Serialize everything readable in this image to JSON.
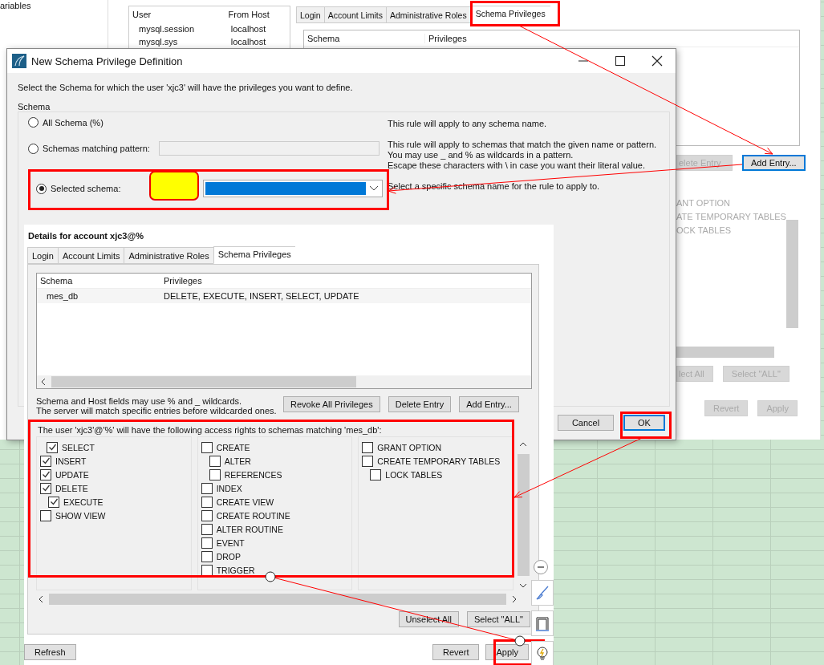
{
  "main_window": {
    "sidebar_label": "ariables",
    "users_table": {
      "columns": [
        "User",
        "From Host"
      ],
      "rows": [
        [
          "mysql.session",
          "localhost"
        ],
        [
          "mysql.sys",
          "localhost"
        ]
      ]
    },
    "tabs": [
      {
        "label": "Login",
        "selected": false
      },
      {
        "label": "Account Limits",
        "selected": false
      },
      {
        "label": "Administrative Roles",
        "selected": false
      },
      {
        "label": "Schema Privileges",
        "selected": true
      }
    ],
    "privileges_table": {
      "columns": [
        "Schema",
        "Privileges"
      ]
    },
    "entry_buttons": [
      {
        "label": "elete Entry",
        "focused": false
      },
      {
        "label": "Add Entry...",
        "focused": true
      }
    ],
    "privileges": [
      "ANT OPTION",
      "ATE TEMPORARY TABLES",
      "OCK TABLES"
    ],
    "select_buttons": [
      "lect All",
      "Select \"ALL\""
    ],
    "footer_buttons": [
      "Revert",
      "Apply"
    ]
  },
  "dialog": {
    "title": "New Schema Privilege Definition",
    "instruction": "Select the Schema for which the user 'xjc3' will have the privileges you want to define.",
    "group_label": "Schema",
    "options": [
      {
        "kind": "plain",
        "label": "All Schema (%)",
        "selected": false,
        "help": [
          "This rule will apply to any schema name."
        ]
      },
      {
        "kind": "pattern",
        "label": "Schemas matching pattern:",
        "selected": false,
        "help": [
          "This rule will apply to schemas that match the given name or pattern.",
          "You may use _ and % as wildcards in a pattern.",
          "Escape these characters with \\ in case you want their literal value."
        ]
      },
      {
        "kind": "dropdown",
        "label": "Selected schema:",
        "selected": true,
        "help": [
          "Select a specific schema name for the rule to apply to."
        ]
      }
    ],
    "buttons": [
      {
        "label": "Cancel",
        "focused": false
      },
      {
        "label": "OK",
        "focused": true
      }
    ]
  },
  "details": {
    "title": "Details for account xjc3@%",
    "tabs": [
      {
        "label": "Login",
        "selected": false
      },
      {
        "label": "Account Limits",
        "selected": false
      },
      {
        "label": "Administrative Roles",
        "selected": false
      },
      {
        "label": "Schema Privileges",
        "selected": true
      }
    ],
    "table": {
      "columns": [
        "Schema",
        "Privileges"
      ],
      "rows": [
        [
          "mes_db",
          "DELETE, EXECUTE, INSERT, SELECT, UPDATE"
        ]
      ]
    },
    "note": [
      "Schema and Host fields may use % and _ wildcards.",
      "The server will match specific entries before wildcarded ones."
    ],
    "entry_buttons": [
      "Revoke All Privileges",
      "Delete Entry",
      "Add Entry..."
    ],
    "rights_heading": "The user 'xjc3'@'%' will have the following access rights to schemas matching 'mes_db':",
    "rights_columns": [
      [
        {
          "label": "SELECT",
          "checked": true
        },
        {
          "label": "INSERT",
          "checked": true
        },
        {
          "label": "UPDATE",
          "checked": true
        },
        {
          "label": "DELETE",
          "checked": true,
          "children": [
            {
              "label": "EXECUTE",
              "checked": true
            }
          ]
        },
        {
          "label": "SHOW VIEW",
          "checked": false
        }
      ],
      [
        {
          "label": "CREATE",
          "checked": false,
          "children": [
            {
              "label": "ALTER",
              "checked": false
            },
            {
              "label": "REFERENCES",
              "checked": false
            }
          ]
        },
        {
          "label": "INDEX",
          "checked": false
        },
        {
          "label": "CREATE VIEW",
          "checked": false
        },
        {
          "label": "CREATE ROUTINE",
          "checked": false
        },
        {
          "label": "ALTER ROUTINE",
          "checked": false
        },
        {
          "label": "EVENT",
          "checked": false
        },
        {
          "label": "DROP",
          "checked": false
        },
        {
          "label": "TRIGGER",
          "checked": false
        }
      ],
      [
        {
          "label": "GRANT OPTION",
          "checked": false
        },
        {
          "label": "CREATE TEMPORARY TABLES",
          "checked": false,
          "children": [
            {
              "label": "LOCK TABLES",
              "checked": false
            }
          ]
        }
      ]
    ],
    "select_buttons": [
      "Unselect All",
      "Select \"ALL\""
    ],
    "footer_left": "Refresh",
    "footer_buttons": [
      "Revert",
      "Apply"
    ]
  }
}
